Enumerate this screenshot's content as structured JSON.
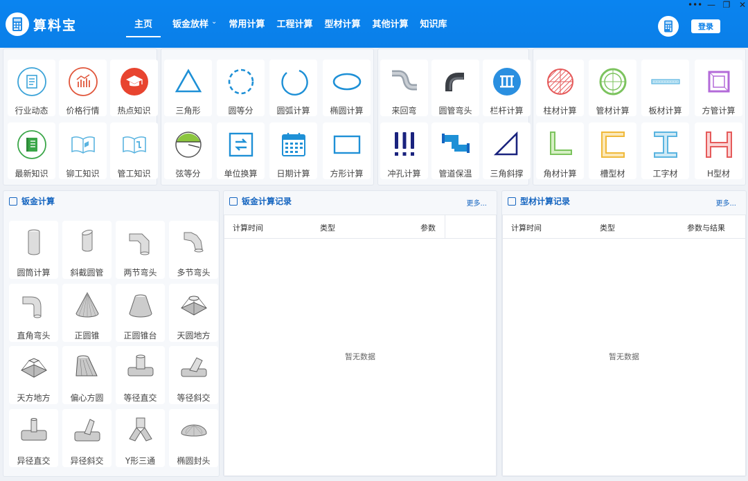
{
  "app": {
    "title": "算料宝",
    "login": "登录"
  },
  "nav": [
    {
      "label": "主页",
      "active": true
    },
    {
      "label": "钣金放样",
      "dropdown": true
    },
    {
      "label": "常用计算"
    },
    {
      "label": "工程计算"
    },
    {
      "label": "型材计算"
    },
    {
      "label": "其他计算"
    },
    {
      "label": "知识库"
    }
  ],
  "window_controls": {
    "more": "•••",
    "minimize": "—",
    "restore": "❐",
    "close": "✕"
  },
  "groups": [
    {
      "tiles": [
        {
          "label": "行业动态",
          "icon": "news-icon"
        },
        {
          "label": "价格行情",
          "icon": "price-chart-icon"
        },
        {
          "label": "热点知识",
          "icon": "graduation-cap-icon"
        },
        {
          "label": "最新知识",
          "icon": "book-icon"
        },
        {
          "label": "铆工知识",
          "icon": "open-book-icon"
        },
        {
          "label": "管工知识",
          "icon": "open-book-pipe-icon"
        }
      ]
    },
    {
      "tiles": [
        {
          "label": "三角形",
          "icon": "triangle-icon"
        },
        {
          "label": "圆等分",
          "icon": "dashed-circle-icon"
        },
        {
          "label": "圆弧计算",
          "icon": "arc-icon"
        },
        {
          "label": "椭圆计算",
          "icon": "ellipse-icon"
        },
        {
          "label": "弦等分",
          "icon": "chord-icon"
        },
        {
          "label": "单位换算",
          "icon": "unit-convert-icon"
        },
        {
          "label": "日期计算",
          "icon": "calendar-icon"
        },
        {
          "label": "方形计算",
          "icon": "rectangle-icon"
        }
      ]
    },
    {
      "tiles": [
        {
          "label": "来回弯",
          "icon": "offset-bend-icon"
        },
        {
          "label": "圆管弯头",
          "icon": "pipe-elbow-icon"
        },
        {
          "label": "栏杆计算",
          "icon": "railing-icon"
        },
        {
          "label": "冲孔计算",
          "icon": "punch-icon"
        },
        {
          "label": "管道保温",
          "icon": "pipe-insulation-icon"
        },
        {
          "label": "三角斜撑",
          "icon": "triangle-brace-icon"
        }
      ]
    },
    {
      "tiles": [
        {
          "label": "柱材计算",
          "icon": "bar-section-icon"
        },
        {
          "label": "管材计算",
          "icon": "tube-section-icon"
        },
        {
          "label": "板材计算",
          "icon": "plate-icon"
        },
        {
          "label": "方管计算",
          "icon": "square-tube-icon"
        },
        {
          "label": "角材计算",
          "icon": "angle-steel-icon"
        },
        {
          "label": "槽型材",
          "icon": "channel-steel-icon"
        },
        {
          "label": "工字材",
          "icon": "i-beam-icon"
        },
        {
          "label": "H型材",
          "icon": "h-beam-icon"
        }
      ]
    }
  ],
  "sheet_metal": {
    "title": "钣金计算",
    "tiles": [
      {
        "label": "圆筒计算",
        "icon": "cylinder-icon"
      },
      {
        "label": "斜截圆管",
        "icon": "oblique-cut-pipe-icon"
      },
      {
        "label": "两节弯头",
        "icon": "two-section-elbow-icon"
      },
      {
        "label": "多节弯头",
        "icon": "multi-section-elbow-icon"
      },
      {
        "label": "直角弯头",
        "icon": "right-angle-elbow-icon"
      },
      {
        "label": "正圆锥",
        "icon": "cone-icon"
      },
      {
        "label": "正圆锥台",
        "icon": "frustum-icon"
      },
      {
        "label": "天圆地方",
        "icon": "round-to-square-icon"
      },
      {
        "label": "天方地方",
        "icon": "square-to-square-icon"
      },
      {
        "label": "偏心方圆",
        "icon": "eccentric-transition-icon"
      },
      {
        "label": "等径直交",
        "icon": "equal-tee-icon"
      },
      {
        "label": "等径斜交",
        "icon": "equal-lateral-icon"
      },
      {
        "label": "异径直交",
        "icon": "reducing-tee-icon"
      },
      {
        "label": "异径斜交",
        "icon": "reducing-lateral-icon"
      },
      {
        "label": "Y形三通",
        "icon": "y-branch-icon"
      },
      {
        "label": "椭圆封头",
        "icon": "elliptical-head-icon"
      }
    ]
  },
  "sheet_records": {
    "title": "钣金计算记录",
    "more": "更多...",
    "columns": [
      "计算时间",
      "类型",
      "参数"
    ],
    "empty": "暂无数据"
  },
  "profile_records": {
    "title": "型材计算记录",
    "more": "更多...",
    "columns": [
      "计算时间",
      "类型",
      "参数与结果"
    ],
    "empty": "暂无数据"
  }
}
